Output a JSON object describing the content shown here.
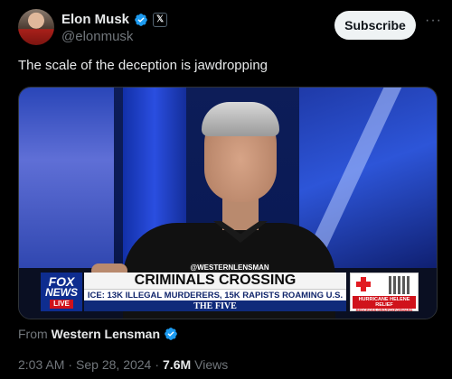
{
  "author": {
    "name": "Elon Musk",
    "handle": "@elonmusk",
    "badge_label": "𝕏"
  },
  "actions": {
    "subscribe_label": "Subscribe",
    "more_label": "···"
  },
  "post": {
    "text": "The scale of the deception is jawdropping"
  },
  "video": {
    "source_tag": "@WESTERNLENSMAN",
    "headline": "CRIMINALS CROSSING",
    "subheadline": "ICE: 13K ILLEGAL MURDERERS, 15K RAPISTS ROAMING U.S.",
    "show_name": "THE FIVE",
    "network_line1": "FOX",
    "network_line2": "NEWS",
    "live_label": "LIVE",
    "promo_text": "HURRICANE HELENE RELIEF",
    "promo_url": "REDCROSS.ORG/FOXFORWARD"
  },
  "attribution": {
    "from_label": "From",
    "source_name": "Western Lensman"
  },
  "meta": {
    "time": "2:03 AM",
    "separator": "·",
    "date": "Sep 28, 2024",
    "separator2": "·",
    "views_count": "7.6M",
    "views_label": "Views"
  },
  "colors": {
    "verified_blue": "#1d9bf0",
    "fox_blue": "#0e2d8f",
    "live_red": "#d0121b"
  }
}
